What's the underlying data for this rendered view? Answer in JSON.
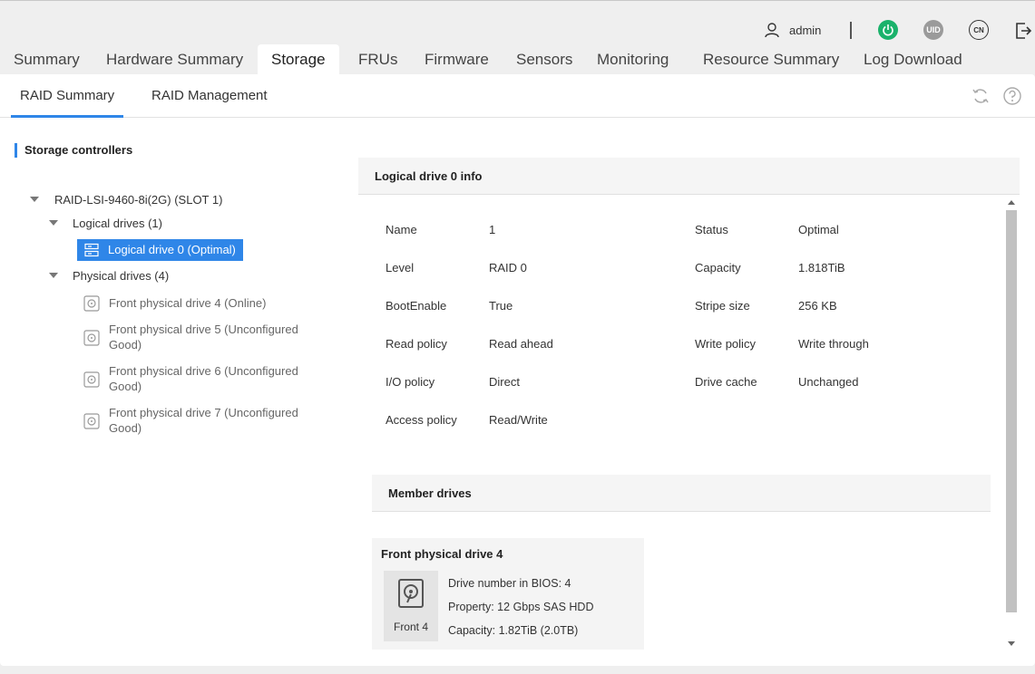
{
  "header": {
    "user": "admin",
    "power_icon": "power-icon",
    "uid_label": "UID",
    "language_label": "CN"
  },
  "tabs": [
    {
      "label": "Summary"
    },
    {
      "label": "Hardware Summary"
    },
    {
      "label": "Storage"
    },
    {
      "label": "FRUs"
    },
    {
      "label": "Firmware"
    },
    {
      "label": "Sensors"
    },
    {
      "label": "Monitoring"
    },
    {
      "label": "Resource Summary"
    },
    {
      "label": "Log Download"
    }
  ],
  "subtabs": [
    {
      "label": "RAID Summary"
    },
    {
      "label": "RAID Management"
    }
  ],
  "tree": {
    "section_title": "Storage controllers",
    "controller": "RAID-LSI-9460-8i(2G) (SLOT 1)",
    "logical_group": "Logical drives (1)",
    "logical_items": [
      "Logical drive 0 (Optimal)"
    ],
    "physical_group": "Physical drives (4)",
    "physical_items": [
      "Front physical drive 4 (Online)",
      "Front physical drive 5 (Unconfigured Good)",
      "Front physical drive 6 (Unconfigured Good)",
      "Front physical drive 7 (Unconfigured Good)"
    ]
  },
  "info": {
    "title": "Logical drive 0 info",
    "left": [
      {
        "label": "Name",
        "value": "1"
      },
      {
        "label": "Level",
        "value": "RAID 0"
      },
      {
        "label": "BootEnable",
        "value": "True"
      },
      {
        "label": "Read policy",
        "value": "Read ahead"
      },
      {
        "label": "I/O policy",
        "value": "Direct"
      },
      {
        "label": "Access policy",
        "value": "Read/Write"
      }
    ],
    "right": [
      {
        "label": "Status",
        "value": "Optimal"
      },
      {
        "label": "Capacity",
        "value": "1.818TiB"
      },
      {
        "label": "Stripe size",
        "value": "256 KB"
      },
      {
        "label": "Write policy",
        "value": "Write through"
      },
      {
        "label": "Drive cache",
        "value": "Unchanged"
      }
    ]
  },
  "members": {
    "title": "Member drives",
    "card": {
      "title": "Front physical drive 4",
      "image_label": "Front 4",
      "lines": [
        "Drive number in BIOS: 4",
        "Property: 12 Gbps SAS HDD",
        "Capacity: 1.82TiB (2.0TB)"
      ]
    }
  },
  "colors": {
    "accent": "#2f86e8",
    "power": "#1ab26b"
  }
}
